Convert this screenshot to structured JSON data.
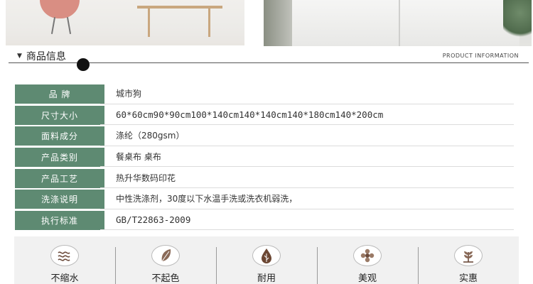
{
  "section": {
    "title": "商品信息",
    "subtitle": "PRODUCT INFORMATION"
  },
  "specs": [
    {
      "label": "品 牌",
      "value": "城市狗"
    },
    {
      "label": "尺寸大小",
      "value": "60*60cm90*90cm100*140cm140*140cm140*180cm140*200cm"
    },
    {
      "label": "面料成分",
      "value": "涤纶（280gsm）"
    },
    {
      "label": "产品类别",
      "value": "餐桌布 桌布"
    },
    {
      "label": "产品工艺",
      "value": "热升华数码印花"
    },
    {
      "label": "洗涤说明",
      "value": "中性洗涤剂，30度以下水温手洗或洗衣机弱洗，"
    },
    {
      "label": "执行标准",
      "value": "GB/T22863-2009"
    }
  ],
  "features": [
    {
      "icon": "wave-icon",
      "label": "不缩水"
    },
    {
      "icon": "leaf-icon",
      "label": "不起色"
    },
    {
      "icon": "drop-icon",
      "label": "耐用"
    },
    {
      "icon": "flower-icon",
      "label": "美观"
    },
    {
      "icon": "plant-icon",
      "label": "实惠"
    }
  ],
  "colors": {
    "label_bg": "#5e8a72",
    "feature_bg": "#f1f1f1"
  }
}
